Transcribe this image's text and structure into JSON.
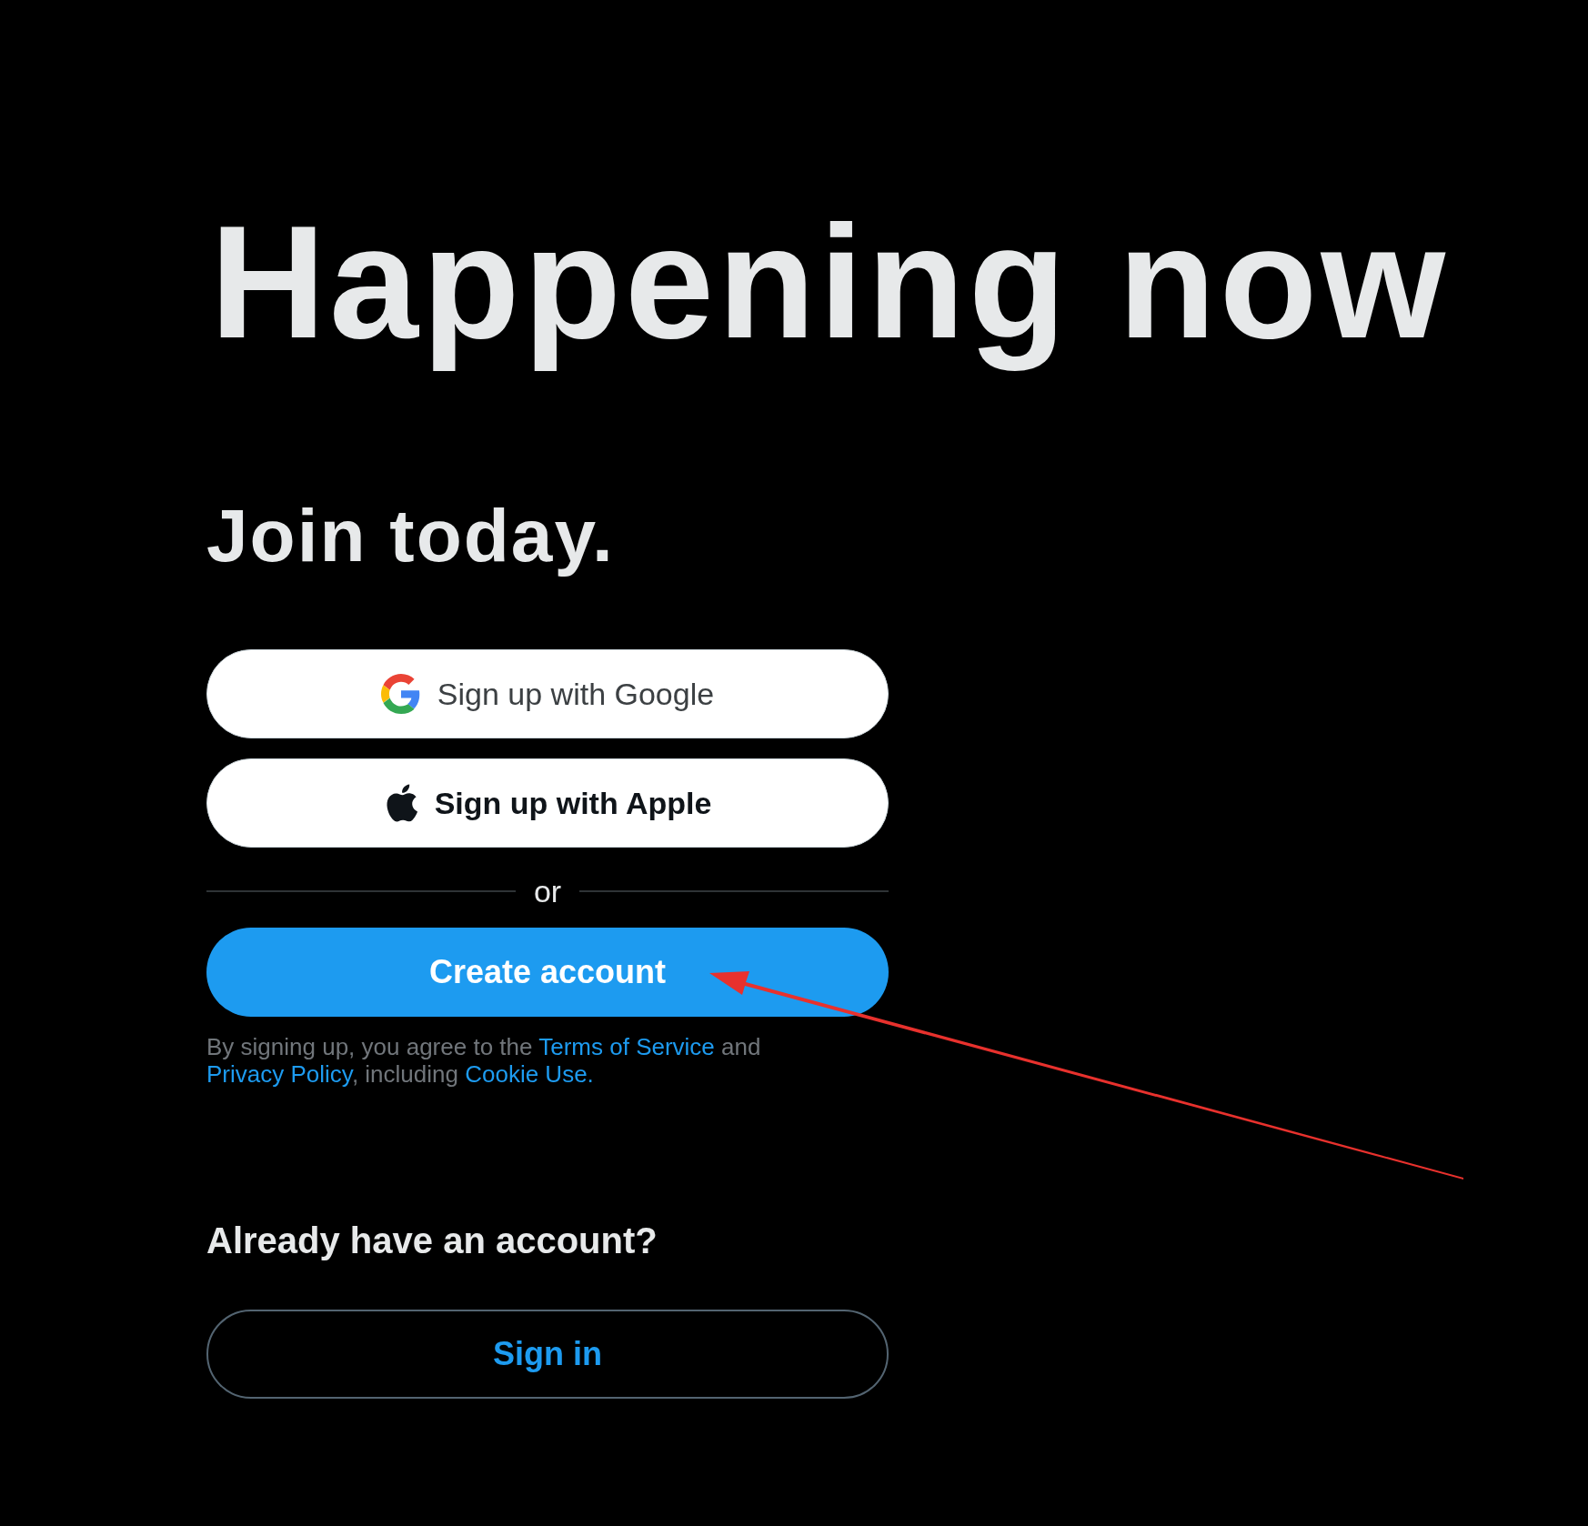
{
  "headline": "Happening now",
  "subheading": "Join today.",
  "buttons": [
    {
      "kind": "google",
      "label": "Sign up with Google"
    },
    {
      "kind": "apple",
      "label": "Sign up with Apple"
    }
  ],
  "divider_text": "or",
  "create_button": "Create account",
  "legal": [
    {
      "text": "By signing up, you agree to the ",
      "link": false
    },
    {
      "text": "Terms of Service",
      "link": true
    },
    {
      "text": " and ",
      "link": false
    },
    {
      "text": "Privacy Policy",
      "link": true
    },
    {
      "text": ", including ",
      "link": false
    },
    {
      "text": "Cookie Use.",
      "link": true
    }
  ],
  "signin_heading": "Already have an account?",
  "signin_button": "Sign in"
}
